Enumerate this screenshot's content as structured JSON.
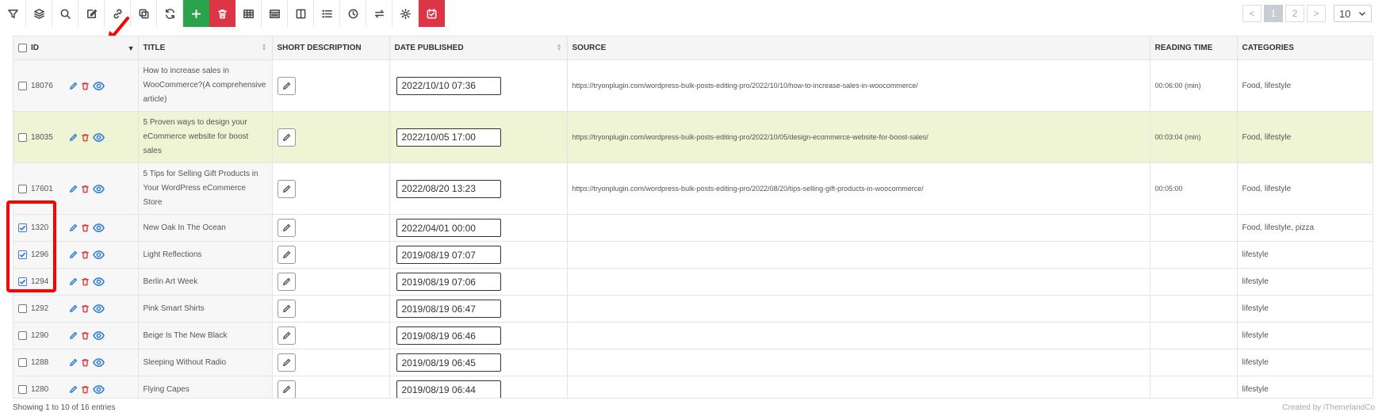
{
  "toolbar": {
    "icons": [
      "filter-icon",
      "layers-icon",
      "search-icon",
      "edit-icon",
      "link-icon",
      "duplicate-icon",
      "refresh-icon",
      "plus-icon",
      "trash-icon",
      "table-icon",
      "columns-icon",
      "split-icon",
      "list-icon",
      "clock-icon",
      "swap-icon",
      "gear-icon",
      "settings-red-icon"
    ],
    "add_color": "#2ba24c",
    "delete_color": "#dc3545"
  },
  "pagination": {
    "prev": "<",
    "pages": [
      "1",
      "2"
    ],
    "next": ">",
    "page_size": "10"
  },
  "columns": {
    "id": "ID",
    "title": "TITLE",
    "short_description": "SHORT DESCRIPTION",
    "date_published": "DATE PUBLISHED",
    "source": "SOURCE",
    "reading_time": "READING TIME",
    "categories": "CATEGORIES"
  },
  "rows": [
    {
      "id": "18076",
      "checked": false,
      "title": "How to increase sales in WooCommerce?(A comprehensive article)",
      "date": "2022/10/10 07:36",
      "source": "https://tryonplugin.com/wordpress-bulk-posts-editing-pro/2022/10/10/how-to-increase-sales-in-woocommerce/",
      "reading_time": "00:06:00 (min)",
      "categories": "Food, lifestyle"
    },
    {
      "id": "18035",
      "checked": false,
      "title": "5 Proven ways to design your eCommerce website for boost sales",
      "date": "2022/10/05 17:00",
      "source": "https://tryonplugin.com/wordpress-bulk-posts-editing-pro/2022/10/05/design-ecommerce-website-for-boost-sales/",
      "reading_time": "00:03:04 (min)",
      "categories": "Food, lifestyle"
    },
    {
      "id": "17601",
      "checked": false,
      "title": "5 Tips for Selling Gift Products in Your WordPress eCommerce Store",
      "date": "2022/08/20 13:23",
      "source": "https://tryonplugin.com/wordpress-bulk-posts-editing-pro/2022/08/20/tips-selling-gift-products-in-woocommerce/",
      "reading_time": "00:05:00",
      "categories": "Food, lifestyle"
    },
    {
      "id": "1320",
      "checked": true,
      "title": "New Oak In The Ocean",
      "date": "2022/04/01 00:00",
      "source": "",
      "reading_time": "",
      "categories": "Food, lifestyle, pizza"
    },
    {
      "id": "1296",
      "checked": true,
      "title": "Light Reflections",
      "date": "2019/08/19 07:07",
      "source": "",
      "reading_time": "",
      "categories": "lifestyle"
    },
    {
      "id": "1294",
      "checked": true,
      "title": "Berlin Art Week",
      "date": "2019/08/19 07:06",
      "source": "",
      "reading_time": "",
      "categories": "lifestyle"
    },
    {
      "id": "1292",
      "checked": false,
      "title": "Pink Smart Shirts",
      "date": "2019/08/19 06:47",
      "source": "",
      "reading_time": "",
      "categories": "lifestyle"
    },
    {
      "id": "1290",
      "checked": false,
      "title": "Beige Is The New Black",
      "date": "2019/08/19 06:46",
      "source": "",
      "reading_time": "",
      "categories": "lifestyle"
    },
    {
      "id": "1288",
      "checked": false,
      "title": "Sleeping Without Radio",
      "date": "2019/08/19 06:45",
      "source": "",
      "reading_time": "",
      "categories": "lifestyle"
    },
    {
      "id": "1280",
      "checked": false,
      "title": "Flying Capes",
      "date": "2019/08/19 06:44",
      "source": "",
      "reading_time": "",
      "categories": "lifestyle"
    }
  ],
  "highlight_row_color": "#eef4d4",
  "annotation_color": "#ff0000",
  "footer": {
    "showing": "Showing 1 to 10 of 16 entries",
    "credit": "Created by iThemelandCo"
  }
}
